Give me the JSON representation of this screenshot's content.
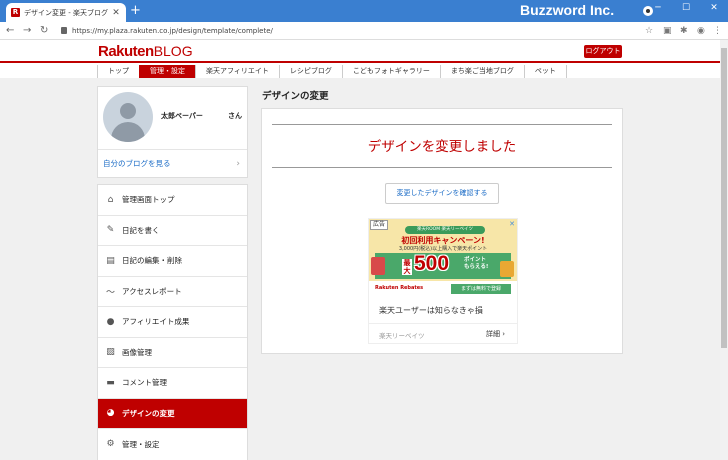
{
  "browser": {
    "tab_title": "デザイン変更 - 楽天ブログ",
    "tab_favicon": "R",
    "brand_text": "Buzzword Inc.",
    "url": "https://my.plaza.rakuten.co.jp/design/template/complete/"
  },
  "site": {
    "logo_main": "Rakuten",
    "logo_sub": "BLOG",
    "logout_label": "ログアウト",
    "accent_color": "#bf0000"
  },
  "global_nav": [
    {
      "label": "トップ"
    },
    {
      "label": "管理・設定",
      "active": true
    },
    {
      "label": "楽天アフィリエイト"
    },
    {
      "label": "レシピブログ"
    },
    {
      "label": "こどもフォトギャラリー"
    },
    {
      "label": "まち楽ご当地ブログ"
    },
    {
      "label": "ペット"
    }
  ],
  "profile": {
    "name": "太郎ペーパー",
    "honorific": "さん",
    "my_blog_link": "自分のブログを見る"
  },
  "side_menu": [
    {
      "label": "管理画面トップ",
      "icon": "home-icon",
      "glyph": "⌂"
    },
    {
      "label": "日記を書く",
      "icon": "pencil-icon",
      "glyph": "✎"
    },
    {
      "label": "日記の編集・削除",
      "icon": "document-icon",
      "glyph": "▤"
    },
    {
      "label": "アクセスレポート",
      "icon": "trend-icon",
      "glyph": "〜"
    },
    {
      "label": "アフィリエイト成果",
      "icon": "moneybag-icon",
      "glyph": "●"
    },
    {
      "label": "画像管理",
      "icon": "image-icon",
      "glyph": "▨"
    },
    {
      "label": "コメント管理",
      "icon": "comment-icon",
      "glyph": "▬"
    },
    {
      "label": "デザインの変更",
      "icon": "palette-icon",
      "glyph": "◕",
      "active": true
    },
    {
      "label": "管理・設定",
      "icon": "gear-icon",
      "glyph": "⚙"
    }
  ],
  "main": {
    "title": "デザインの変更",
    "message": "デザインを変更しました",
    "confirm_button": "変更したデザインを確認する"
  },
  "ad": {
    "tag": "広告",
    "pill": "楽天ROOM 楽天リーベイツ",
    "campaign": "初回利用キャンペーン!",
    "condition": "3,000円(税込)以上購入で楽天ポイント",
    "max_label": "最大",
    "amount": "500",
    "points": "ポイント\nもらえる!",
    "logo": "Rakuten Rebates",
    "cta": "まずは無料で登録",
    "description": "楽天ユーザーは知らなきゃ損",
    "source": "楽天リーベイツ",
    "more": "詳細"
  }
}
